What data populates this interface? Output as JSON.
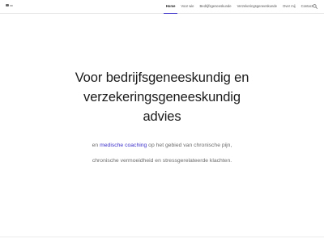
{
  "colors": {
    "accent": "#3b2fc9",
    "text_dark": "#1a1a1a",
    "text_muted": "#6b6b6b",
    "nav_text": "#555555",
    "divider": "#e6e6e6"
  },
  "header": {
    "logo_icon": "logo-icon",
    "nav": [
      {
        "label": "Home",
        "active": true
      },
      {
        "label": "Voor wie",
        "active": false
      },
      {
        "label": "Bedrijfsgeneeskunde",
        "active": false
      },
      {
        "label": "Verzekeringsgeneeskunde",
        "active": false
      },
      {
        "label": "Over mij",
        "active": false
      },
      {
        "label": "Contact",
        "active": false
      }
    ],
    "search_icon": "search-icon"
  },
  "hero": {
    "title_line_1": "Voor bedrijfsgeneeskundig en verzekeringsgeneeskundig",
    "title_line_2": "advies"
  },
  "intro": {
    "line1_prefix": "en ",
    "line1_link": "medische coaching",
    "line1_suffix": " op het gebied van chronische pijn,",
    "line2": "chronische vermoeidheid en stressgerelateerde klachten."
  }
}
